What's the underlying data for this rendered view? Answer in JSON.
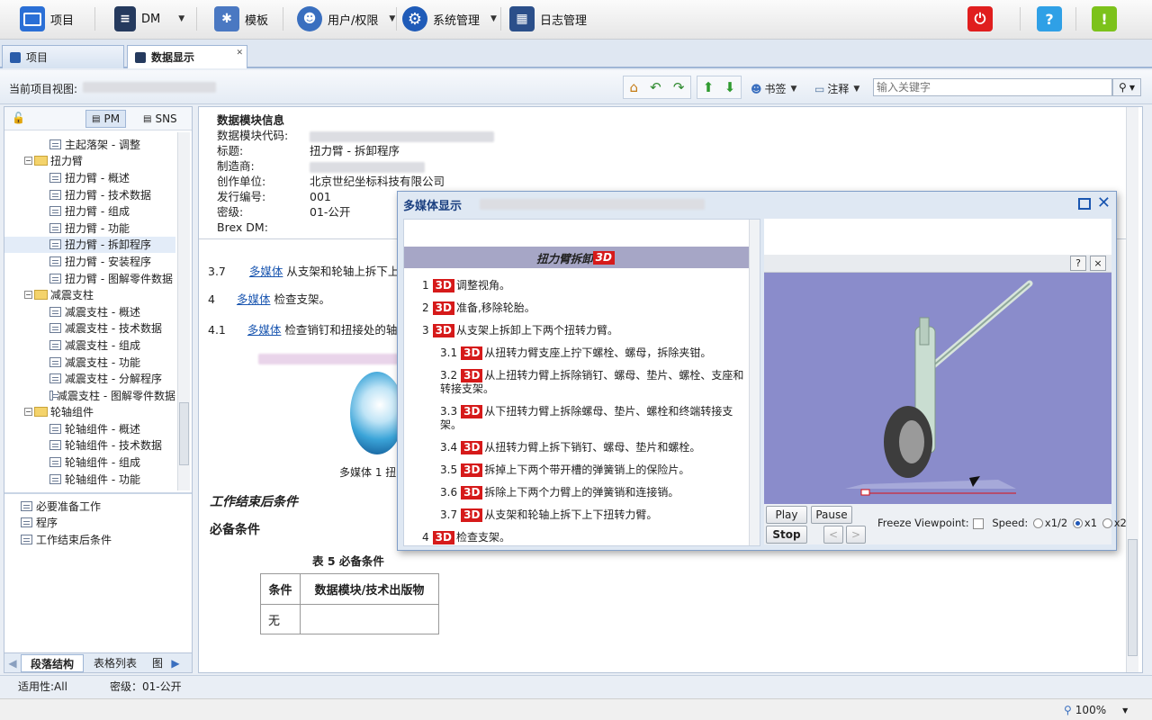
{
  "toolbar": {
    "project_label": "项目",
    "dm_label": "DM",
    "template_label": "模板",
    "users_label": "用户/权限",
    "system_label": "系统管理",
    "log_label": "日志管理",
    "help_glyph": "?",
    "alert_glyph": "!"
  },
  "tabs": [
    {
      "label": "项目"
    },
    {
      "label": "数据显示"
    }
  ],
  "viewbar": {
    "current_view_label": "当前项目视图:",
    "bookmark_label": "书签",
    "note_label": "注释",
    "search_placeholder": "输入关键字"
  },
  "left_panel": {
    "pm_label": "PM",
    "sns_label": "SNS",
    "tree": [
      {
        "label": "主起落架 - 调整",
        "level": 2,
        "type": "page"
      },
      {
        "label": "扭力臂",
        "level": 1,
        "type": "folder"
      },
      {
        "label": "扭力臂 - 概述",
        "level": 2,
        "type": "page"
      },
      {
        "label": "扭力臂 - 技术数据",
        "level": 2,
        "type": "page"
      },
      {
        "label": "扭力臂 - 组成",
        "level": 2,
        "type": "page"
      },
      {
        "label": "扭力臂 - 功能",
        "level": 2,
        "type": "page"
      },
      {
        "label": "扭力臂 - 拆卸程序",
        "level": 2,
        "type": "page",
        "selected": true
      },
      {
        "label": "扭力臂 - 安装程序",
        "level": 2,
        "type": "page"
      },
      {
        "label": "扭力臂 - 图解零件数据",
        "level": 2,
        "type": "page"
      },
      {
        "label": "减震支柱",
        "level": 1,
        "type": "folder"
      },
      {
        "label": "减震支柱 - 概述",
        "level": 2,
        "type": "page"
      },
      {
        "label": "减震支柱 - 技术数据",
        "level": 2,
        "type": "page"
      },
      {
        "label": "减震支柱 - 组成",
        "level": 2,
        "type": "page"
      },
      {
        "label": "减震支柱 - 功能",
        "level": 2,
        "type": "page"
      },
      {
        "label": "减震支柱 - 分解程序",
        "level": 2,
        "type": "page"
      },
      {
        "label": "减震支柱 - 图解零件数据",
        "level": 2,
        "type": "page"
      },
      {
        "label": "轮轴组件",
        "level": 1,
        "type": "folder"
      },
      {
        "label": "轮轴组件 - 概述",
        "level": 2,
        "type": "page"
      },
      {
        "label": "轮轴组件 - 技术数据",
        "level": 2,
        "type": "page"
      },
      {
        "label": "轮轴组件 - 组成",
        "level": 2,
        "type": "page"
      },
      {
        "label": "轮轴组件 - 功能",
        "level": 2,
        "type": "page"
      }
    ],
    "outline": [
      "必要准备工作",
      "程序",
      "工作结束后条件"
    ],
    "bottom_tabs": [
      "段落结构",
      "表格列表",
      "图"
    ]
  },
  "dm_info": {
    "heading": "数据模块信息",
    "code_label": "数据模块代码:",
    "title_label": "标题:",
    "title_value": "扭力臂 - 拆卸程序",
    "maker_label": "制造商:",
    "author_label": "创作单位:",
    "author_value": "北京世纪坐标科技有限公司",
    "issue_label": "发行编号:",
    "issue_value": "001",
    "security_label": "密级:",
    "security_value": "01-公开",
    "brex_label": "Brex DM:"
  },
  "doc": {
    "steps": [
      {
        "num": "3.7",
        "link": "多媒体",
        "text": "从支架和轮轴上拆下上"
      },
      {
        "num": "4",
        "link": "多媒体",
        "text": "检查支架。"
      },
      {
        "num": "4.1",
        "link": "多媒体",
        "text": "检查销钉和扭接处的轴"
      }
    ],
    "figure_caption": "多媒体 1 扭",
    "after_heading": "工作结束后条件",
    "required_heading": "必备条件",
    "table_caption": "表 5 必备条件",
    "table_headers": [
      "条件",
      "数据模块/技术出版物"
    ],
    "table_rows": [
      [
        "无",
        ""
      ]
    ]
  },
  "multimedia": {
    "title": "多媒体显示",
    "panel_title": "扭力臂拆卸",
    "badge": "3D",
    "steps": [
      {
        "num": "1",
        "text": "调整视角。",
        "indent": 0
      },
      {
        "num": "2",
        "text": "准备,移除轮胎。",
        "indent": 0
      },
      {
        "num": "3",
        "text": "从支架上拆卸上下两个扭转力臂。",
        "indent": 0
      },
      {
        "num": "3.1",
        "text": "从扭转力臂支座上拧下螺栓、螺母，拆除夹钳。",
        "indent": 1
      },
      {
        "num": "3.2",
        "text": "从上扭转力臂上拆除销钉、螺母、垫片、螺栓、支座和转接支架。",
        "indent": 1
      },
      {
        "num": "3.3",
        "text": "从下扭转力臂上拆除螺母、垫片、螺栓和终端转接支架。",
        "indent": 1
      },
      {
        "num": "3.4",
        "text": "从扭转力臂上拆下销钉、螺母、垫片和螺栓。",
        "indent": 1
      },
      {
        "num": "3.5",
        "text": "拆掉上下两个带开槽的弹簧销上的保险片。",
        "indent": 1
      },
      {
        "num": "3.6",
        "text": "拆除上下两个力臂上的弹簧销和连接销。",
        "indent": 1
      },
      {
        "num": "3.7",
        "text": "从支架和轮轴上拆下上下扭转力臂。",
        "indent": 1
      },
      {
        "num": "4",
        "text": "检查支架。",
        "indent": 0
      }
    ],
    "viewer": {
      "help": "?",
      "close": "×",
      "play": "Play",
      "pause": "Pause",
      "stop": "Stop",
      "prev": "<",
      "next": ">",
      "freeze_label": "Freeze Viewpoint:",
      "speed_label": "Speed:",
      "speed_options": [
        "x1/2",
        "x1",
        "x2"
      ],
      "speed_selected": "x1"
    }
  },
  "status": {
    "applicability": "适用性:All",
    "security": "密级：01-公开",
    "zoom": "100%"
  },
  "colors": {
    "accent": "#1a3f80",
    "badge_red": "#d61a1a",
    "viewer_bg": "#8a8ccb"
  }
}
